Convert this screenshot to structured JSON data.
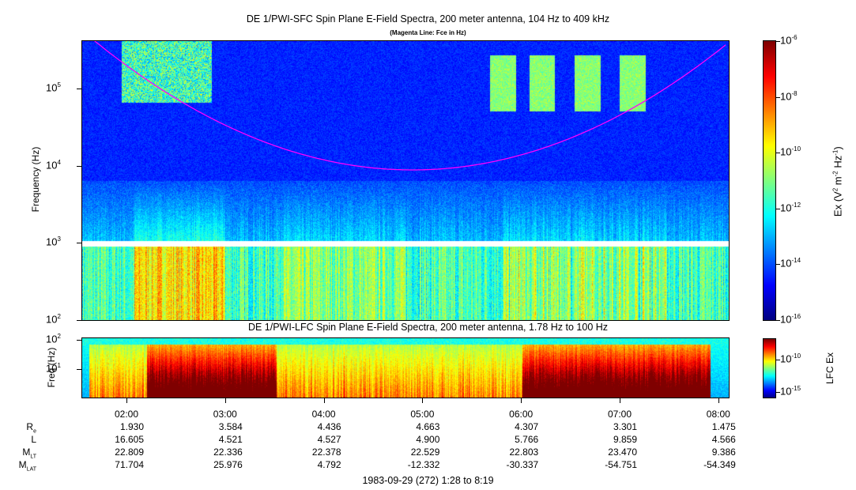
{
  "chart_data": [
    {
      "type": "heatmap",
      "title": "DE 1/PWI-SFC  Spin Plane E-Field Spectra, 200 meter antenna, 104 Hz to 409 kHz",
      "subtitle": "(Magenta Line: Fce in Hz)",
      "ylabel": "Frequency (Hz)",
      "yscale": "log",
      "ylim": [
        100,
        409000
      ],
      "yticks": [
        "10^2",
        "10^3",
        "10^4",
        "10^5"
      ],
      "colorbar": {
        "label": "Ex (V^2 m^-2 Hz^-1)",
        "range": [
          1e-16,
          1e-06
        ],
        "ticks": [
          "10^-16",
          "10^-14",
          "10^-12",
          "10^-10",
          "10^-8",
          "10^-6"
        ]
      },
      "overlay": {
        "name": "Fce",
        "color": "#ff00ff"
      }
    },
    {
      "type": "heatmap",
      "title": "DE 1/PWI-LFC  Spin Plane E-Field Spectra, 200 meter antenna, 1.78 Hz to 100 Hz",
      "ylabel": "Freq (Hz)",
      "yscale": "log",
      "ylim": [
        1.78,
        100
      ],
      "yticks": [
        "10^1",
        "10^2"
      ],
      "colorbar": {
        "label": "LFC Ex",
        "ticks": [
          "10^-10",
          "10^-15"
        ]
      }
    }
  ],
  "time_axis": {
    "ticks": [
      "02:00",
      "03:00",
      "04:00",
      "05:00",
      "06:00",
      "07:00",
      "08:00"
    ],
    "caption": "1983-09-29 (272) 1:28 to 8:19"
  },
  "ephemeris": [
    {
      "label": "R",
      "sub": "e",
      "values": [
        "1.930",
        "3.584",
        "4.436",
        "4.663",
        "4.307",
        "3.301",
        "1.475"
      ]
    },
    {
      "label": "L",
      "sub": "",
      "values": [
        "16.605",
        "4.521",
        "4.527",
        "4.900",
        "5.766",
        "9.859",
        "4.566"
      ]
    },
    {
      "label": "M",
      "sub": "LT",
      "values": [
        "22.809",
        "22.336",
        "22.378",
        "22.529",
        "22.803",
        "23.470",
        "9.386"
      ]
    },
    {
      "label": "M",
      "sub": "LAT",
      "values": [
        "71.704",
        "25.976",
        "4.792",
        "-12.332",
        "-30.337",
        "-54.751",
        "-54.349"
      ]
    }
  ]
}
